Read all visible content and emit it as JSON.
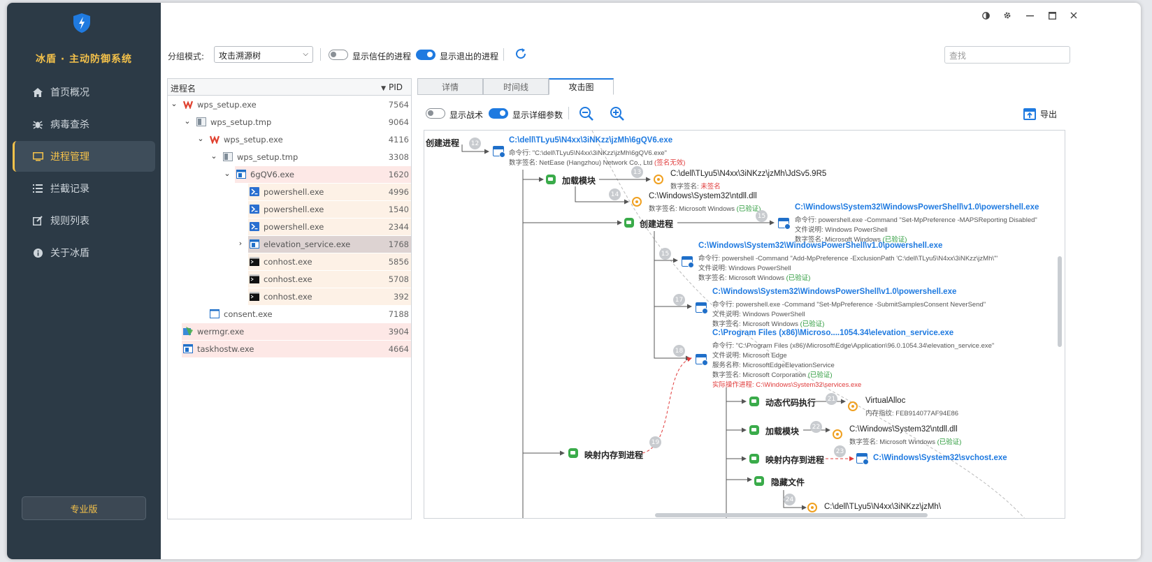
{
  "app": {
    "title": "冰盾 · 主动防御系统",
    "accent": "#f5c24a",
    "brand_blue": "#1f7ae0"
  },
  "sidebar": {
    "items": [
      {
        "label": "首页概况",
        "icon": "home-icon"
      },
      {
        "label": "病毒查杀",
        "icon": "bug-icon"
      },
      {
        "label": "进程管理",
        "icon": "monitor-icon",
        "active": true
      },
      {
        "label": "拦截记录",
        "icon": "list-icon"
      },
      {
        "label": "规则列表",
        "icon": "edit-icon"
      },
      {
        "label": "关于冰盾",
        "icon": "info-icon"
      }
    ],
    "pro_label": "专业版"
  },
  "window_controls": [
    "theme-icon",
    "gear-icon",
    "minimize-icon",
    "maximize-icon",
    "close-icon"
  ],
  "toolbar": {
    "group_label": "分组模式:",
    "group_value": "攻击溯源树",
    "show_trusted": "显示信任的进程",
    "show_trusted_on": false,
    "show_exited": "显示退出的进程",
    "show_exited_on": true,
    "search_placeholder": "查找"
  },
  "tree": {
    "col_name": "进程名",
    "col_pid": "PID",
    "rows": [
      {
        "name": "wps_setup.exe",
        "pid": "7564"
      },
      {
        "name": "wps_setup.tmp",
        "pid": "9064"
      },
      {
        "name": "wps_setup.exe",
        "pid": "4116"
      },
      {
        "name": "wps_setup.tmp",
        "pid": "3308"
      },
      {
        "name": "6gQV6.exe",
        "pid": "1620"
      },
      {
        "name": "powershell.exe",
        "pid": "4996"
      },
      {
        "name": "powershell.exe",
        "pid": "1540"
      },
      {
        "name": "powershell.exe",
        "pid": "2344"
      },
      {
        "name": "elevation_service.exe",
        "pid": "1768"
      },
      {
        "name": "conhost.exe",
        "pid": "5856"
      },
      {
        "name": "conhost.exe",
        "pid": "5708"
      },
      {
        "name": "conhost.exe",
        "pid": "392"
      },
      {
        "name": "consent.exe",
        "pid": "7188"
      },
      {
        "name": "wermgr.exe",
        "pid": "3904"
      },
      {
        "name": "taskhostw.exe",
        "pid": "4664"
      }
    ]
  },
  "tabs": [
    {
      "label": "详情"
    },
    {
      "label": "时间线"
    },
    {
      "label": "攻击图",
      "active": true
    }
  ],
  "graph_toolbar": {
    "show_tactics": "显示战术",
    "show_tactics_on": false,
    "show_params": "显示详细参数",
    "show_params_on": true,
    "export": "导出"
  },
  "graph": {
    "root_action": "创建进程",
    "n12": {
      "num": "12",
      "path": "C:\\dell\\TLyu5\\N4xx\\3iNKzz\\jzMh\\6gQV6.exe",
      "cmd": "命令行: \"C:\\dell\\TLyu5\\N4xx\\3iNKzz\\jzMh\\6gQV6.exe\"",
      "sig": "数字签名: NetEase (Hangzhou) Network Co., Ltd",
      "sig_status": "(签名无效)"
    },
    "a_load1": "加载模块",
    "n13": {
      "num": "13",
      "path": "C:\\dell\\TLyu5\\N4xx\\3iNKzz\\jzMh\\JdSv5.9R5",
      "sig": "数字签名:",
      "sig_status": "未签名"
    },
    "n14": {
      "num": "14",
      "path": "C:\\Windows\\System32\\ntdll.dll",
      "sig": "数字签名: Microsoft Windows",
      "sig_status": "(已验证)"
    },
    "a_create2": "创建进程",
    "n15a": {
      "num": "15",
      "path": "C:\\Windows\\System32\\WindowsPowerShell\\v1.0\\powershell.exe",
      "cmd": "命令行: powershell.exe -Command \"Set-MpPreference -MAPSReporting Disabled\"",
      "desc": "文件说明: Windows PowerShell",
      "sig": "数字签名: Microsoft Windows",
      "sig_status": "(已验证)"
    },
    "n15b": {
      "num": "15",
      "path": "C:\\Windows\\System32\\WindowsPowerShell\\v1.0\\powershell.exe",
      "cmd": "命令行: powershell -Command \"Add-MpPreference -ExclusionPath 'C:\\dell\\TLyu5\\N4xx\\3iNKzz\\jzMh\\'\"",
      "desc": "文件说明: Windows PowerShell",
      "sig": "数字签名: Microsoft Windows",
      "sig_status": "(已验证)"
    },
    "n17": {
      "num": "17",
      "path": "C:\\Windows\\System32\\WindowsPowerShell\\v1.0\\powershell.exe",
      "cmd": "命令行: powershell.exe -Command \"Set-MpPreference -SubmitSamplesConsent NeverSend\"",
      "desc": "文件说明: Windows PowerShell",
      "sig": "数字签名: Microsoft Windows",
      "sig_status": "(已验证)"
    },
    "n18": {
      "num": "18",
      "path": "C:\\Program Files (x86)\\Microso....1054.34\\elevation_service.exe",
      "cmd": "命令行: \"C:\\Program Files (x86)\\Microsoft\\Edge\\Application\\96.0.1054.34\\elevation_service.exe\"",
      "desc": "文件说明: Microsoft Edge",
      "svc": "服务名称: MicrosoftEdgeElevationService",
      "sig": "数字签名: Microsoft Corporation",
      "sig_status": "(已验证)",
      "real_label": "实际操作进程:",
      "real_path": "C:\\Windows\\System32\\services.exe"
    },
    "a_dyn": "动态代码执行",
    "n21": {
      "num": "21",
      "name": "VirtualAlloc",
      "mem": "内存指纹: FEB914077AF94E86"
    },
    "a_load2": "加载模块",
    "n22": {
      "num": "22",
      "path": "C:\\Windows\\System32\\ntdll.dll",
      "sig": "数字签名: Microsoft Windows",
      "sig_status": "(已验证)"
    },
    "a_map2": "映射内存到进程",
    "n23": {
      "num": "23",
      "path": "C:\\Windows\\System32\\svchost.exe"
    },
    "a_hide": "隐藏文件",
    "n24": {
      "num": "24",
      "path": "C:\\dell\\TLyu5\\N4xx\\3iNKzz\\jzMh\\"
    },
    "a_map1": "映射内存到进程",
    "n19": {
      "num": "19"
    }
  }
}
